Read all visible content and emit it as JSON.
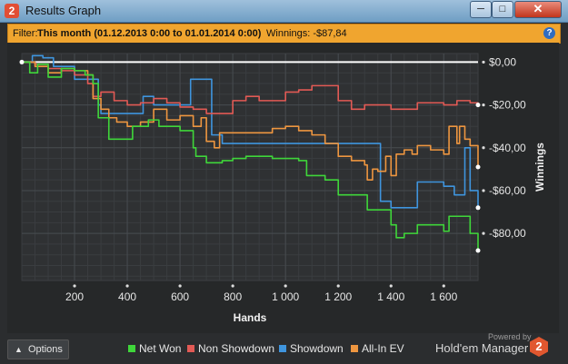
{
  "window": {
    "title": "Results Graph",
    "app_icon": "2",
    "minimize_icon": "minimize-icon",
    "maximize_icon": "maximize-icon",
    "close_icon": "close-icon"
  },
  "filter": {
    "prefix": "Filter:",
    "range": "This month (01.12.2013 0:00 to 01.01.2014 0:00)",
    "winnings": "Winnings: -$87,84",
    "help": "?"
  },
  "colors": {
    "net_won": "#3fd63a",
    "non_showdown": "#e25a55",
    "showdown": "#3f95de",
    "all_in_ev": "#ee9640",
    "filter_bar": "#f0a52f",
    "zero_line": "#ffffff"
  },
  "chart_data": {
    "type": "line",
    "xlabel": "Hands",
    "ylabel": "Winnings",
    "xlim": [
      0,
      1730
    ],
    "ylim": [
      -102,
      4
    ],
    "x_ticks": [
      200,
      400,
      600,
      800,
      1000,
      1200,
      1400,
      1600
    ],
    "x_tick_labels": [
      "200",
      "400",
      "600",
      "800",
      "1 000",
      "1 200",
      "1 400",
      "1 600"
    ],
    "y_ticks": [
      0,
      -20,
      -40,
      -60,
      -80
    ],
    "y_tick_labels": [
      "$0,00",
      "-$20,00",
      "-$40,00",
      "-$60,00",
      "-$80,00"
    ],
    "grid": true,
    "legend": "bottom",
    "series": [
      {
        "name": "Net Won",
        "color": "#3fd63a",
        "x": [
          0,
          30,
          60,
          100,
          150,
          200,
          240,
          270,
          290,
          330,
          400,
          420,
          480,
          520,
          560,
          600,
          650,
          660,
          700,
          760,
          800,
          850,
          950,
          1050,
          1080,
          1150,
          1200,
          1300,
          1310,
          1350,
          1400,
          1420,
          1450,
          1500,
          1600,
          1620,
          1700,
          1730
        ],
        "y": [
          0,
          -5,
          -1,
          -7,
          -3,
          -4,
          -6,
          -10,
          -26,
          -36,
          -36,
          -30,
          -27,
          -30,
          -30,
          -32,
          -40,
          -44,
          -47,
          -46,
          -45,
          -44,
          -45,
          -46,
          -53,
          -55,
          -62,
          -62,
          -69,
          -69,
          -76,
          -82,
          -80,
          -76,
          -79,
          -72,
          -80,
          -88
        ]
      },
      {
        "name": "Non Showdown",
        "color": "#e25a55",
        "x": [
          0,
          50,
          100,
          150,
          200,
          250,
          270,
          300,
          350,
          400,
          450,
          500,
          550,
          600,
          650,
          700,
          800,
          850,
          900,
          1000,
          1050,
          1100,
          1200,
          1250,
          1300,
          1400,
          1500,
          1600,
          1650,
          1700,
          1730
        ],
        "y": [
          0,
          -1,
          -3,
          -4,
          -6,
          -10,
          -16,
          -14,
          -18,
          -20,
          -19,
          -17,
          -19,
          -21,
          -22,
          -24,
          -18,
          -16,
          -18,
          -14,
          -13,
          -11,
          -18,
          -22,
          -20,
          -22,
          -19,
          -20,
          -18,
          -19,
          -20
        ]
      },
      {
        "name": "Showdown",
        "color": "#3f95de",
        "x": [
          0,
          40,
          80,
          120,
          160,
          200,
          250,
          290,
          300,
          440,
          460,
          500,
          600,
          640,
          700,
          720,
          760,
          1100,
          1200,
          1350,
          1360,
          1400,
          1500,
          1600,
          1640,
          1680,
          1700,
          1730
        ],
        "y": [
          0,
          3,
          2,
          -2,
          -2,
          -8,
          -8,
          -20,
          -24,
          -24,
          -16,
          -20,
          -20,
          -8,
          -8,
          -34,
          -38,
          -38,
          -38,
          -38,
          -65,
          -68,
          -56,
          -58,
          -62,
          -40,
          -60,
          -68
        ]
      },
      {
        "name": "All-In EV",
        "color": "#ee9640",
        "x": [
          0,
          50,
          100,
          150,
          200,
          250,
          270,
          300,
          330,
          360,
          400,
          450,
          500,
          550,
          600,
          650,
          680,
          700,
          730,
          750,
          800,
          850,
          950,
          1000,
          1050,
          1100,
          1150,
          1200,
          1250,
          1300,
          1310,
          1330,
          1350,
          1380,
          1400,
          1420,
          1450,
          1480,
          1500,
          1550,
          1600,
          1620,
          1650,
          1660,
          1680,
          1700,
          1730
        ],
        "y": [
          0,
          -2,
          -5,
          -3,
          -4,
          -6,
          -17,
          -22,
          -26,
          -28,
          -30,
          -28,
          -22,
          -27,
          -25,
          -30,
          -26,
          -37,
          -40,
          -33,
          -33,
          -33,
          -31,
          -30,
          -32,
          -34,
          -38,
          -44,
          -46,
          -48,
          -55,
          -50,
          -51,
          -44,
          -53,
          -43,
          -41,
          -43,
          -39,
          -41,
          -43,
          -30,
          -38,
          -30,
          -36,
          -39,
          -49
        ]
      }
    ]
  },
  "options": {
    "label": "Options",
    "chevron_icon": "chevron-up-icon"
  },
  "legend": [
    {
      "label": "Net Won",
      "color": "#3fd63a"
    },
    {
      "label": "Non Showdown",
      "color": "#e25a55"
    },
    {
      "label": "Showdown",
      "color": "#3f95de"
    },
    {
      "label": "All-In EV",
      "color": "#ee9640"
    }
  ],
  "branding": {
    "powered_by": "Powered by",
    "name": "Hold'em Manager",
    "logo": "2"
  }
}
